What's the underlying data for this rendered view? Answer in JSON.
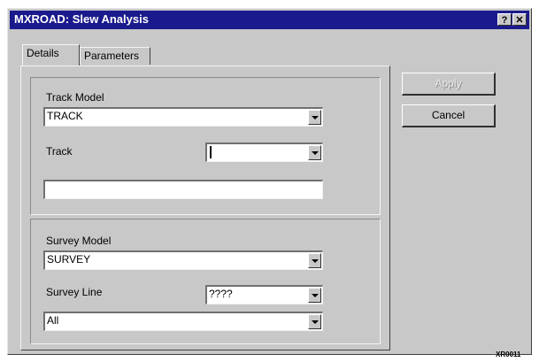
{
  "window": {
    "title": "MXROAD: Slew Analysis",
    "help_button": "?",
    "close_button": "✕"
  },
  "tabs": [
    {
      "label": "Details",
      "active": true
    },
    {
      "label": "Parameters",
      "active": false
    }
  ],
  "track_group": {
    "model_label": "Track Model",
    "model_value": "TRACK",
    "track_label": "Track",
    "track_value": "",
    "description_value": ""
  },
  "survey_group": {
    "model_label": "Survey Model",
    "model_value": "SURVEY",
    "line_label": "Survey Line",
    "line_value": "????",
    "filter_value": "All"
  },
  "buttons": {
    "apply": "Apply",
    "cancel": "Cancel"
  },
  "figure_code": "XR0011"
}
